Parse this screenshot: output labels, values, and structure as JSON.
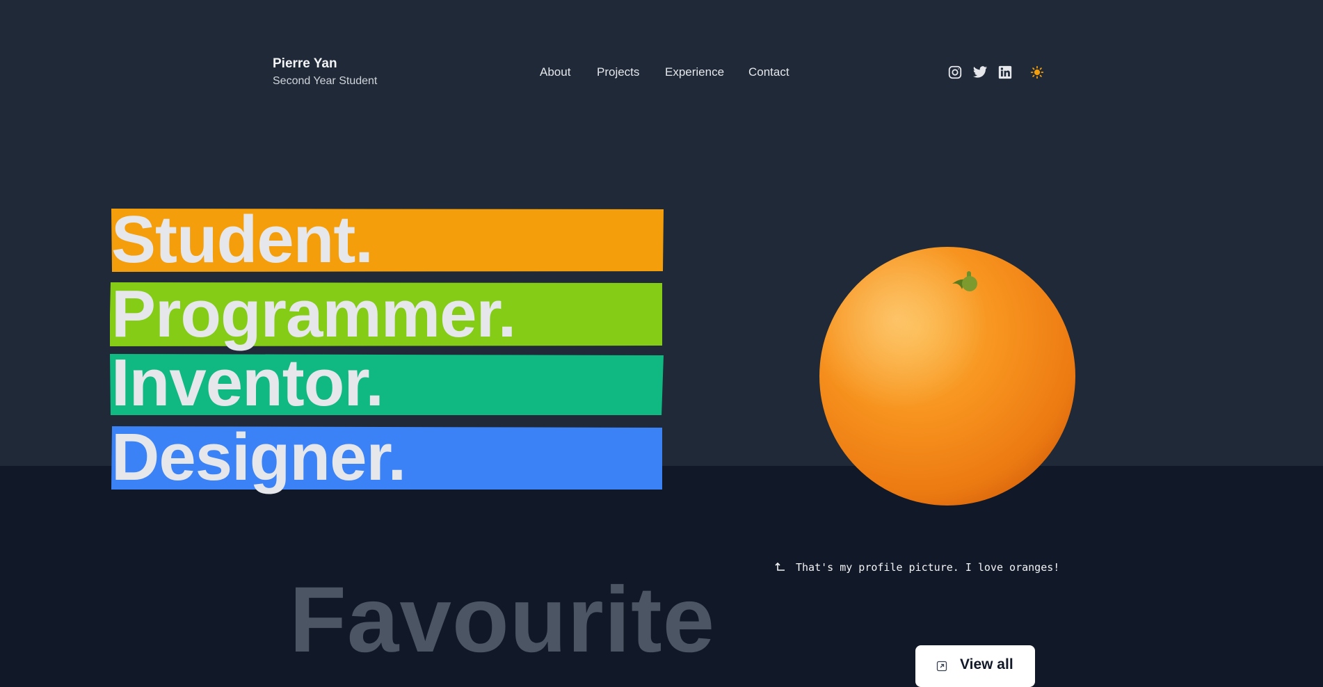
{
  "header": {
    "name": "Pierre Yan",
    "subtitle": "Second Year Student",
    "nav": [
      "About",
      "Projects",
      "Experience",
      "Contact"
    ],
    "socials": [
      "instagram-icon",
      "twitter-icon",
      "linkedin-icon",
      "sun-icon"
    ]
  },
  "hero": {
    "words": [
      {
        "text": "Student.",
        "color": "#f59e0b"
      },
      {
        "text": "Programmer.",
        "color": "#84cc16"
      },
      {
        "text": "Inventor.",
        "color": "#10b981"
      },
      {
        "text": "Designer.",
        "color": "#3b82f6"
      }
    ],
    "caption": "That's my profile picture. I love oranges!"
  },
  "section": {
    "heading": "Favourite",
    "view_all": "View all"
  },
  "colors": {
    "top_bg": "#1f2937",
    "bottom_bg": "#111827",
    "sun": "#f59e0b"
  }
}
